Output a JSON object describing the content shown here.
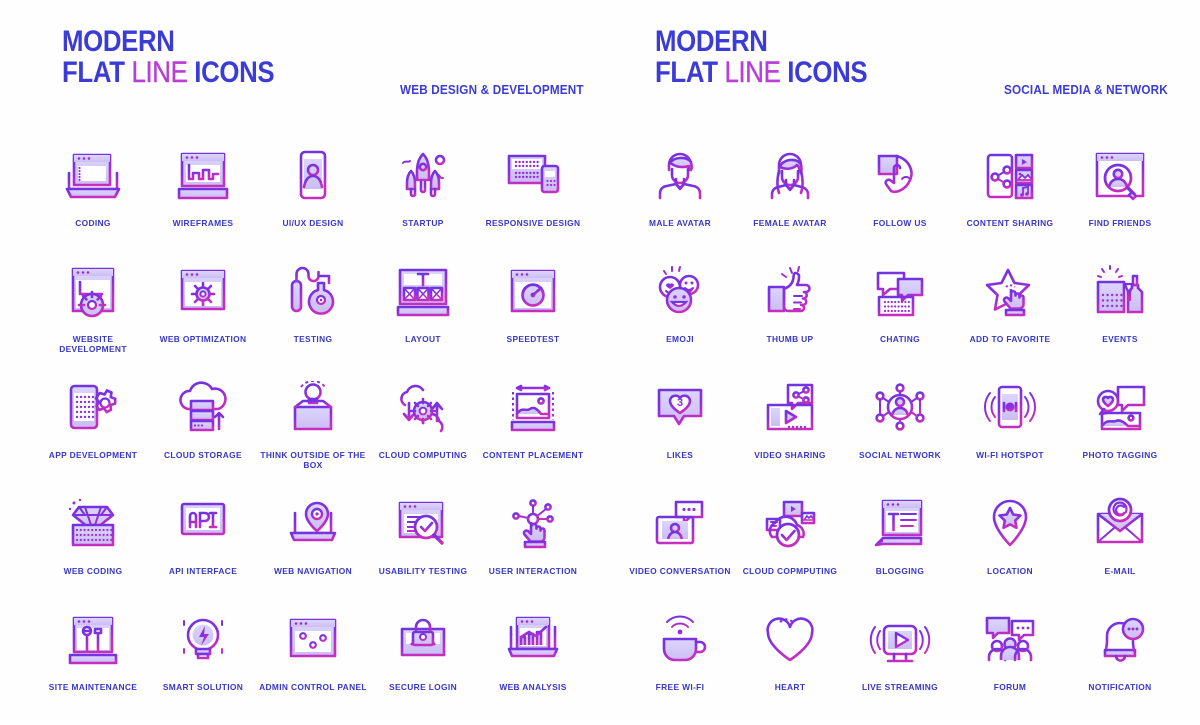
{
  "colors": {
    "stroke_top": "#6d34e0",
    "stroke_bottom": "#c02fc0",
    "fill_light": "#cfc2f5",
    "fill_lighter": "#e3dcfa",
    "brand_blue": "#3b3bd6",
    "brand_pink": "#b83fd6",
    "caption": "#3838c4",
    "background": "#fefeff"
  },
  "sections": [
    {
      "brand_line1": "MODERN",
      "brand_flat": "FLAT",
      "brand_line": "LINE",
      "brand_icons": "ICONS",
      "subtitle": "WEB DESIGN & DEVELOPMENT",
      "icons": [
        {
          "label": "CODING",
          "icon": "coding-icon"
        },
        {
          "label": "WIREFRAMES",
          "icon": "wireframes-icon"
        },
        {
          "label": "UI/UX DESIGN",
          "icon": "ui-ux-design-icon"
        },
        {
          "label": "STARTUP",
          "icon": "startup-rocket-icon"
        },
        {
          "label": "RESPONSIVE DESIGN",
          "icon": "responsive-design-icon"
        },
        {
          "label": "WEBSITE DEVELOPMENT",
          "icon": "website-development-icon"
        },
        {
          "label": "WEB OPTIMIZATION",
          "icon": "web-optimization-icon"
        },
        {
          "label": "TESTING",
          "icon": "testing-flask-icon"
        },
        {
          "label": "LAYOUT",
          "icon": "layout-icon"
        },
        {
          "label": "SPEEDTEST",
          "icon": "speedtest-icon"
        },
        {
          "label": "APP DEVELOPMENT",
          "icon": "app-development-icon"
        },
        {
          "label": "CLOUD STORAGE",
          "icon": "cloud-storage-icon"
        },
        {
          "label": "THINK OUTSIDE OF THE BOX",
          "icon": "think-outside-box-icon"
        },
        {
          "label": "CLOUD COMPUTING",
          "icon": "cloud-computing-icon"
        },
        {
          "label": "CONTENT PLACEMENT",
          "icon": "content-placement-icon"
        },
        {
          "label": "WEB CODING",
          "icon": "web-coding-diamond-icon"
        },
        {
          "label": "API INTERFACE",
          "icon": "api-interface-icon"
        },
        {
          "label": "WEB NAVIGATION",
          "icon": "web-navigation-icon"
        },
        {
          "label": "USABILITY TESTING",
          "icon": "usability-testing-icon"
        },
        {
          "label": "USER INTERACTION",
          "icon": "user-interaction-icon"
        },
        {
          "label": "SITE MAINTENANCE",
          "icon": "site-maintenance-icon"
        },
        {
          "label": "SMART SOLUTION",
          "icon": "smart-solution-bulb-icon"
        },
        {
          "label": "ADMIN CONTROL PANEL",
          "icon": "admin-control-panel-icon"
        },
        {
          "label": "SECURE LOGIN",
          "icon": "secure-login-icon"
        },
        {
          "label": "WEB ANALYSIS",
          "icon": "web-analysis-icon"
        }
      ]
    },
    {
      "brand_line1": "MODERN",
      "brand_flat": "FLAT",
      "brand_line": "LINE",
      "brand_icons": "ICONS",
      "subtitle": "SOCIAL MEDIA & NETWORK",
      "icons": [
        {
          "label": "MALE AVATAR",
          "icon": "male-avatar-icon"
        },
        {
          "label": "FEMALE AVATAR",
          "icon": "female-avatar-icon"
        },
        {
          "label": "FOLLOW US",
          "icon": "follow-us-hand-icon"
        },
        {
          "label": "CONTENT SHARING",
          "icon": "content-sharing-icon"
        },
        {
          "label": "FIND FRIENDS",
          "icon": "find-friends-icon"
        },
        {
          "label": "EMOJI",
          "icon": "emoji-icon"
        },
        {
          "label": "THUMB UP",
          "icon": "thumb-up-icon"
        },
        {
          "label": "CHATING",
          "icon": "chating-icon"
        },
        {
          "label": "ADD TO FAVORITE",
          "icon": "add-to-favorite-star-icon"
        },
        {
          "label": "EVENTS",
          "icon": "events-calendar-icon"
        },
        {
          "label": "LIKES",
          "icon": "likes-heart-icon",
          "badge": "3"
        },
        {
          "label": "VIDEO SHARING",
          "icon": "video-sharing-icon"
        },
        {
          "label": "SOCIAL NETWORK",
          "icon": "social-network-icon"
        },
        {
          "label": "WI-FI HOTSPOT",
          "icon": "wifi-hotspot-icon"
        },
        {
          "label": "PHOTO TAGGING",
          "icon": "photo-tagging-icon"
        },
        {
          "label": "VIDEO CONVERSATION",
          "icon": "video-conversation-icon"
        },
        {
          "label": "CLOUD COPMPUTING",
          "icon": "cloud-copmputing-icon"
        },
        {
          "label": "BLOGGING",
          "icon": "blogging-icon"
        },
        {
          "label": "LOCATION",
          "icon": "location-star-pin-icon"
        },
        {
          "label": "E-MAIL",
          "icon": "email-icon"
        },
        {
          "label": "FREE WI-FI",
          "icon": "free-wifi-cup-icon"
        },
        {
          "label": "HEART",
          "icon": "heart-icon"
        },
        {
          "label": "LIVE STREAMING",
          "icon": "live-streaming-icon"
        },
        {
          "label": "FORUM",
          "icon": "forum-icon"
        },
        {
          "label": "NOTIFICATION",
          "icon": "notification-bell-icon"
        }
      ]
    }
  ]
}
